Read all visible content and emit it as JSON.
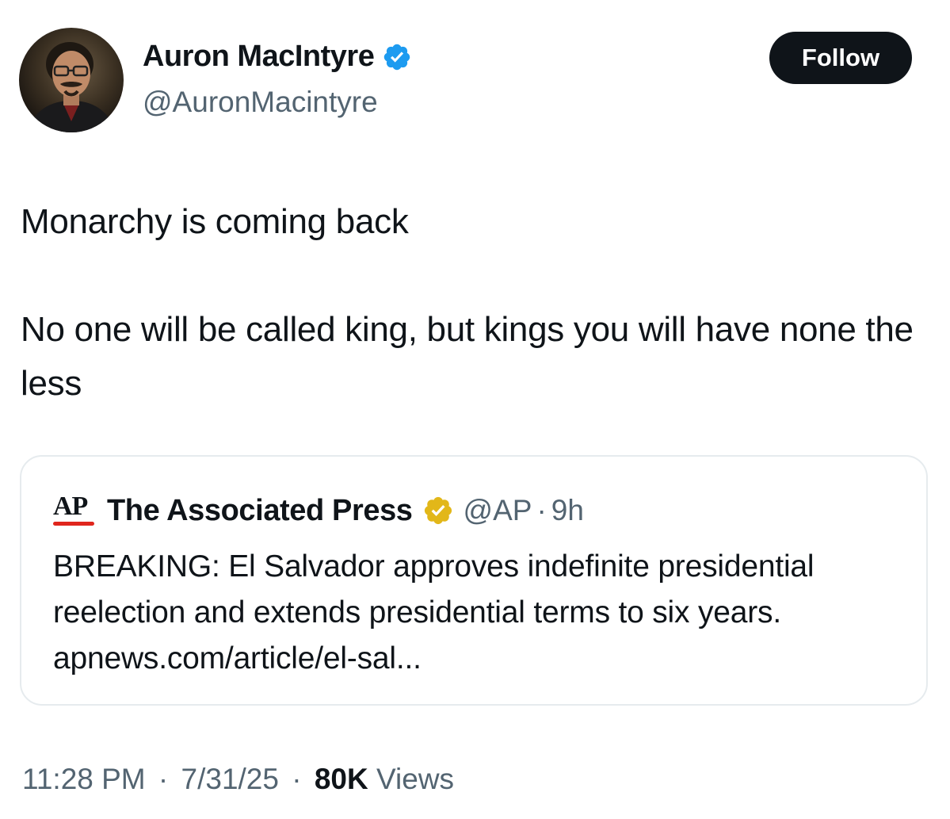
{
  "author": {
    "display_name": "Auron MacIntyre",
    "handle": "@AuronMacintyre",
    "verified_icon": "blue-verified-badge-icon"
  },
  "follow_label": "Follow",
  "tweet_text": "Monarchy is coming back\n\nNo one will be called king, but kings you will have none the less",
  "quoted_tweet": {
    "logo_text": "AP",
    "author_name": "The Associated Press",
    "verified_icon": "gold-verified-badge-icon",
    "handle": "@AP",
    "separator": "·",
    "time_ago": "9h",
    "text": "BREAKING: El Salvador approves indefinite presidential reelection and extends presidential terms to six years. apnews.com/article/el-sal..."
  },
  "footer": {
    "time": "11:28 PM",
    "separator": "·",
    "date": "7/31/25",
    "views_count": "80K",
    "views_label": "Views"
  },
  "colors": {
    "text": "#0f1419",
    "secondary": "#536471",
    "verified_blue": "#1d9bf0",
    "verified_gold": "#e2b719",
    "ap_red": "#e0261d",
    "border": "#e6ebee"
  }
}
